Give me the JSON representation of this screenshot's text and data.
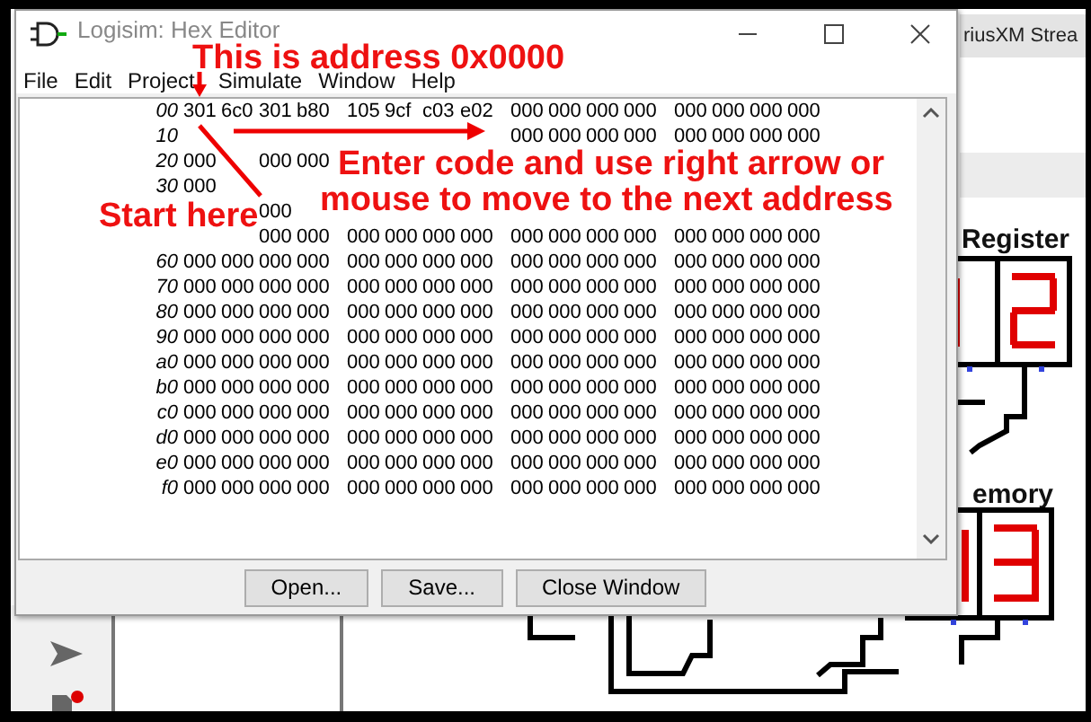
{
  "background": {
    "tab": "riusXM Strea",
    "labels": [
      "Register",
      "emory"
    ]
  },
  "window": {
    "title": "Logisim: Hex Editor"
  },
  "menu": [
    "File",
    "Edit",
    "Project",
    "Simulate",
    "Window",
    "Help"
  ],
  "hex": [
    {
      "label": "00",
      "values": [
        "301",
        "6c0",
        "301",
        "b80",
        "105",
        "9cf",
        "c03",
        "e02",
        "000",
        "000",
        "000",
        "000",
        "000",
        "000",
        "000",
        "000"
      ]
    },
    {
      "label": "10",
      "cells": [
        {
          "covered": true
        },
        {
          "covered": true
        },
        {
          "covered": true
        },
        {
          "covered": true
        },
        {
          "covered": true
        },
        {
          "covered": true
        },
        {
          "covered": true
        },
        {
          "covered": true
        },
        {
          "value": "000"
        },
        {
          "value": "000"
        },
        {
          "value": "000"
        },
        {
          "value": "000"
        },
        {
          "value": "000"
        },
        {
          "value": "000"
        },
        {
          "value": "000"
        },
        {
          "value": "000"
        }
      ]
    },
    {
      "label": "20",
      "cells": [
        {
          "value": "000"
        },
        {
          "covered": true
        },
        {
          "value": "000"
        },
        {
          "value": "000"
        },
        {
          "covered": true
        },
        {
          "covered": true
        },
        {
          "covered": true
        },
        {
          "covered": true
        },
        {
          "covered": true
        },
        {
          "covered": true
        },
        {
          "covered": true
        },
        {
          "covered": true
        },
        {
          "covered": true
        },
        {
          "covered": true
        },
        {
          "covered": true
        },
        {
          "covered": true
        }
      ]
    },
    {
      "label": "30",
      "cells": [
        {
          "value": "000"
        },
        {
          "covered": true
        },
        {
          "covered": true
        },
        {
          "covered": true
        },
        {
          "covered": true
        },
        {
          "covered": true
        },
        {
          "covered": true
        },
        {
          "covered": true
        },
        {
          "covered": true
        },
        {
          "covered": true
        },
        {
          "covered": true
        },
        {
          "covered": true
        },
        {
          "covered": true
        },
        {
          "covered": true
        },
        {
          "covered": true
        },
        {
          "covered": true
        }
      ]
    },
    {
      "cells": [
        {
          "covered": true
        },
        {
          "covered": true
        },
        {
          "value": "000"
        },
        {
          "covered": true
        },
        {
          "covered": true
        },
        {
          "covered": true
        },
        {
          "covered": true
        },
        {
          "covered": true
        },
        {
          "covered": true
        },
        {
          "covered": true
        },
        {
          "covered": true
        },
        {
          "covered": true
        },
        {
          "covered": true
        },
        {
          "covered": true
        },
        {
          "covered": true
        },
        {
          "covered": true
        }
      ]
    },
    {
      "cells": [
        {
          "covered": true
        },
        {
          "covered": true
        },
        {
          "value": "000"
        },
        {
          "value": "000"
        },
        {
          "value": "000"
        },
        {
          "value": "000"
        },
        {
          "value": "000"
        },
        {
          "value": "000"
        },
        {
          "value": "000"
        },
        {
          "value": "000"
        },
        {
          "value": "000"
        },
        {
          "value": "000"
        },
        {
          "value": "000"
        },
        {
          "value": "000"
        },
        {
          "value": "000"
        },
        {
          "value": "000"
        }
      ]
    },
    {
      "label": "60",
      "values": [
        "000",
        "000",
        "000",
        "000",
        "000",
        "000",
        "000",
        "000",
        "000",
        "000",
        "000",
        "000",
        "000",
        "000",
        "000",
        "000"
      ]
    },
    {
      "label": "70",
      "values": [
        "000",
        "000",
        "000",
        "000",
        "000",
        "000",
        "000",
        "000",
        "000",
        "000",
        "000",
        "000",
        "000",
        "000",
        "000",
        "000"
      ]
    },
    {
      "label": "80",
      "values": [
        "000",
        "000",
        "000",
        "000",
        "000",
        "000",
        "000",
        "000",
        "000",
        "000",
        "000",
        "000",
        "000",
        "000",
        "000",
        "000"
      ]
    },
    {
      "label": "90",
      "values": [
        "000",
        "000",
        "000",
        "000",
        "000",
        "000",
        "000",
        "000",
        "000",
        "000",
        "000",
        "000",
        "000",
        "000",
        "000",
        "000"
      ]
    },
    {
      "label": "a0",
      "values": [
        "000",
        "000",
        "000",
        "000",
        "000",
        "000",
        "000",
        "000",
        "000",
        "000",
        "000",
        "000",
        "000",
        "000",
        "000",
        "000"
      ]
    },
    {
      "label": "b0",
      "values": [
        "000",
        "000",
        "000",
        "000",
        "000",
        "000",
        "000",
        "000",
        "000",
        "000",
        "000",
        "000",
        "000",
        "000",
        "000",
        "000"
      ]
    },
    {
      "label": "c0",
      "values": [
        "000",
        "000",
        "000",
        "000",
        "000",
        "000",
        "000",
        "000",
        "000",
        "000",
        "000",
        "000",
        "000",
        "000",
        "000",
        "000"
      ]
    },
    {
      "label": "d0",
      "values": [
        "000",
        "000",
        "000",
        "000",
        "000",
        "000",
        "000",
        "000",
        "000",
        "000",
        "000",
        "000",
        "000",
        "000",
        "000",
        "000"
      ]
    },
    {
      "label": "e0",
      "values": [
        "000",
        "000",
        "000",
        "000",
        "000",
        "000",
        "000",
        "000",
        "000",
        "000",
        "000",
        "000",
        "000",
        "000",
        "000",
        "000"
      ]
    },
    {
      "label": "f0",
      "values": [
        "000",
        "000",
        "000",
        "000",
        "000",
        "000",
        "000",
        "000",
        "000",
        "000",
        "000",
        "000",
        "000",
        "000",
        "000",
        "000"
      ]
    }
  ],
  "buttons": [
    "Open...",
    "Save...",
    "Close Window"
  ],
  "annotations": [
    "This is address 0x0000",
    "Enter code and use right arrow or",
    "mouse to move to the next address",
    "Start here"
  ]
}
